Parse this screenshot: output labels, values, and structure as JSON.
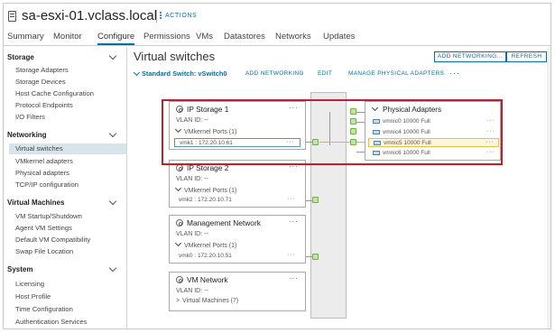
{
  "header": {
    "host_name": "sa-esxi-01.vclass.local",
    "actions_label": "ACTIONS"
  },
  "tabs": [
    {
      "label": "Summary"
    },
    {
      "label": "Monitor"
    },
    {
      "label": "Configure",
      "active": true
    },
    {
      "label": "Permissions"
    },
    {
      "label": "VMs"
    },
    {
      "label": "Datastores"
    },
    {
      "label": "Networks"
    },
    {
      "label": "Updates"
    }
  ],
  "sidebar": {
    "storage": {
      "title": "Storage",
      "items": [
        "Storage Adapters",
        "Storage Devices",
        "Host Cache Configuration",
        "Protocol Endpoints",
        "I/O Filters"
      ]
    },
    "networking": {
      "title": "Networking",
      "items": [
        "Virtual switches",
        "VMkernel adapters",
        "Physical adapters",
        "TCP/IP configuration"
      ],
      "selected": "Virtual switches"
    },
    "virtual_machines": {
      "title": "Virtual Machines",
      "items": [
        "VM Startup/Shutdown",
        "Agent VM Settings",
        "Default VM Compatibility",
        "Swap File Location"
      ]
    },
    "system": {
      "title": "System",
      "items": [
        "Licensing",
        "Host Profile",
        "Time Configuration",
        "Authentication Services"
      ]
    }
  },
  "main": {
    "title": "Virtual switches",
    "add_networking_button": "ADD NETWORKING...",
    "refresh_button": "REFRESH",
    "switch": {
      "name": "Standard Switch: vSwitch0",
      "add_networking": "ADD NETWORKING",
      "edit": "EDIT",
      "manage_physical_adapters": "MANAGE PHYSICAL ADAPTERS",
      "more": "···"
    },
    "port_groups": [
      {
        "name": "IP Storage 1",
        "vlan": "VLAN ID: --",
        "ports_label": "VMkernel Ports (1)",
        "adapter": "vmk1 : 172.20.10.61",
        "selected": true
      },
      {
        "name": "IP Storage 2",
        "vlan": "VLAN ID: --",
        "ports_label": "VMkernel Ports (1)",
        "adapter": "vmk2 : 172.20.10.71"
      },
      {
        "name": "Management Network",
        "vlan": "VLAN ID: --",
        "ports_label": "VMkernel Ports (1)",
        "adapter": "vmk0 : 172.20.10.51"
      },
      {
        "name": "VM Network",
        "vlan": "VLAN ID: --",
        "ports_label": "Virtual Machines (7)"
      }
    ],
    "physical_adapters": {
      "title": "Physical Adapters",
      "nics": [
        {
          "label": "vmnic0 10000 Full"
        },
        {
          "label": "vmnic4 10000 Full"
        },
        {
          "label": "vmnic5 10000 Full",
          "selected": true
        },
        {
          "label": "vmnic6 10000 Full"
        }
      ]
    },
    "more_glyph": "···"
  },
  "colors": {
    "accent": "#0072a3",
    "highlight_box": "#c21f2e",
    "selected_nic_bg": "#fdf6dc",
    "port_green": "#6bb33d"
  }
}
